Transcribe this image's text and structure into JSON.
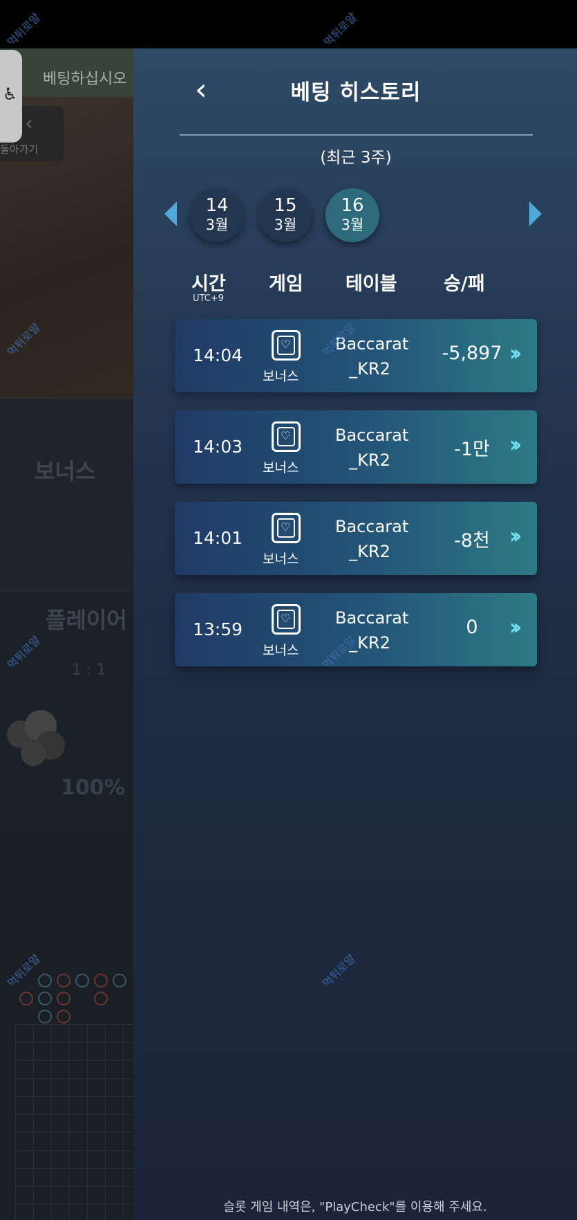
{
  "background": {
    "banner_text": "베팅하십시오",
    "back_label": "돌아가기",
    "bonus_label": "보너스",
    "player_label": "플레이어",
    "ratio": "1 : 1",
    "percent": "100%"
  },
  "header": {
    "title": "베팅 히스토리",
    "subtitle": "(최근 3주)"
  },
  "dates": [
    {
      "day": "14",
      "month": "3월"
    },
    {
      "day": "15",
      "month": "3월"
    },
    {
      "day": "16",
      "month": "3월"
    }
  ],
  "columns": {
    "time": "시간",
    "time_sub": "UTC+9",
    "game": "게임",
    "table": "테이블",
    "result": "승/패"
  },
  "rows": [
    {
      "time": "14:04",
      "game": "보너스",
      "table_line1": "Baccarat",
      "table_line2": "_KR2",
      "result": "-5,897"
    },
    {
      "time": "14:03",
      "game": "보너스",
      "table_line1": "Baccarat",
      "table_line2": "_KR2",
      "result": "-1만"
    },
    {
      "time": "14:01",
      "game": "보너스",
      "table_line1": "Baccarat",
      "table_line2": "_KR2",
      "result": "-8천"
    },
    {
      "time": "13:59",
      "game": "보너스",
      "table_line1": "Baccarat",
      "table_line2": "_KR2",
      "result": "0"
    }
  ],
  "footer": {
    "note": "슬롯 게임 내역은, \"PlayCheck\"를 이용해 주세요."
  },
  "watermark": "먹튀로얄",
  "colors": {
    "panel_top": "#2e4a66",
    "panel_bottom": "#1b2438",
    "accent_arrow": "#4fa8d8",
    "active_date": "#2e6a7e",
    "row_chevron": "#6fe0f0"
  },
  "icons": {
    "back": "chevron-left-icon",
    "game": "card-heart-icon",
    "row_action": "double-chevron-right-icon",
    "accessibility": "accessibility-icon"
  }
}
